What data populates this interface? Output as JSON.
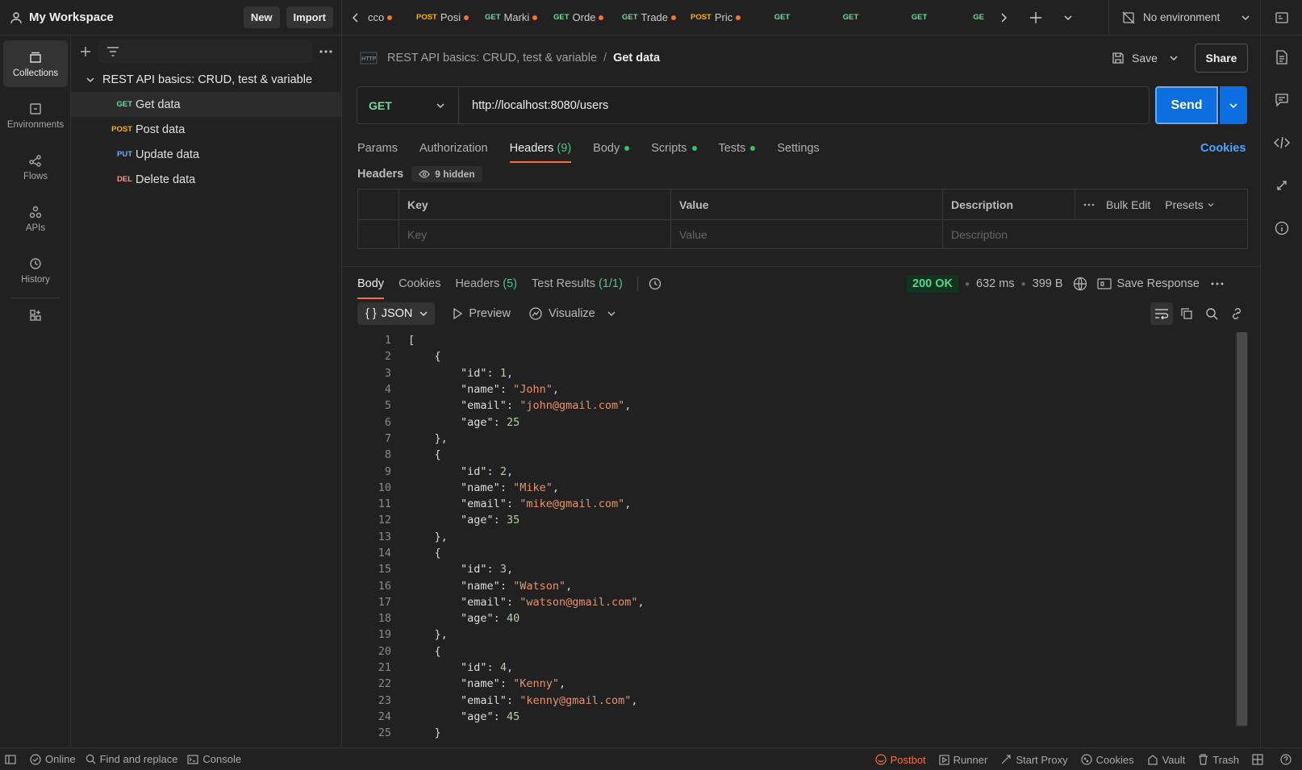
{
  "workspace": {
    "title": "My Workspace",
    "new_label": "New",
    "import_label": "Import"
  },
  "rail": [
    {
      "label": "Collections",
      "icon": "collections-icon"
    },
    {
      "label": "Environments",
      "icon": "environments-icon"
    },
    {
      "label": "Flows",
      "icon": "flows-icon"
    },
    {
      "label": "APIs",
      "icon": "apis-icon"
    },
    {
      "label": "History",
      "icon": "history-icon"
    }
  ],
  "sidebar": {
    "collection": "REST API basics: CRUD, test & variable",
    "requests": [
      {
        "method": "GET",
        "name": "Get data",
        "color": "#6bdd9a"
      },
      {
        "method": "POST",
        "name": "Post data",
        "color": "#ffb400"
      },
      {
        "method": "PUT",
        "name": "Update data",
        "color": "#74aef6"
      },
      {
        "method": "DEL",
        "name": "Delete data",
        "color": "#f79a8e"
      }
    ]
  },
  "tabs": [
    {
      "method": "",
      "name": "cco",
      "dot": true
    },
    {
      "method": "POST",
      "name": "Posi",
      "dot": true
    },
    {
      "method": "GET",
      "name": "Marki",
      "dot": true
    },
    {
      "method": "GET",
      "name": "Orde",
      "dot": true
    },
    {
      "method": "GET",
      "name": "Trade",
      "dot": true
    },
    {
      "method": "POST",
      "name": "Pric",
      "dot": true
    },
    {
      "method": "GET",
      "name": "",
      "dot": false
    },
    {
      "method": "GET",
      "name": "",
      "dot": false
    },
    {
      "method": "GET",
      "name": "",
      "dot": false
    },
    {
      "method": "GE",
      "name": "",
      "dot": false
    }
  ],
  "environment": "No environment",
  "request": {
    "breadcrumb_collection": "REST API basics: CRUD, test & variable",
    "breadcrumb_sep": "/",
    "breadcrumb_request": "Get data",
    "save_label": "Save",
    "share_label": "Share",
    "method": "GET",
    "url": "http://localhost:8080/users",
    "send_label": "Send",
    "tabs": {
      "params": "Params",
      "authorization": "Authorization",
      "headers": "Headers",
      "headers_count": "(9)",
      "body": "Body",
      "scripts": "Scripts",
      "tests": "Tests",
      "settings": "Settings"
    },
    "cookies_link": "Cookies",
    "headers_label": "Headers",
    "hidden_label": "9 hidden",
    "table": {
      "key": "Key",
      "value": "Value",
      "description": "Description",
      "bulk_edit": "Bulk Edit",
      "presets": "Presets",
      "key_ph": "Key",
      "value_ph": "Value",
      "description_ph": "Description"
    }
  },
  "response": {
    "tabs": {
      "body": "Body",
      "cookies": "Cookies",
      "headers": "Headers",
      "headers_count": "(5)",
      "tests": "Test Results",
      "tests_count": "(1/1)"
    },
    "status": "200 OK",
    "time": "632 ms",
    "size": "399 B",
    "save_response": "Save Response",
    "format": "JSON",
    "preview": "Preview",
    "visualize": "Visualize",
    "lines": [
      "[",
      "    {",
      "        \"id\": 1,",
      "        \"name\": \"John\",",
      "        \"email\": \"john@gmail.com\",",
      "        \"age\": 25",
      "    },",
      "    {",
      "        \"id\": 2,",
      "        \"name\": \"Mike\",",
      "        \"email\": \"mike@gmail.com\",",
      "        \"age\": 35",
      "    },",
      "    {",
      "        \"id\": 3,",
      "        \"name\": \"Watson\",",
      "        \"email\": \"watson@gmail.com\",",
      "        \"age\": 40",
      "    },",
      "    {",
      "        \"id\": 4,",
      "        \"name\": \"Kenny\",",
      "        \"email\": \"kenny@gmail.com\",",
      "        \"age\": 45",
      "    }"
    ]
  },
  "statusbar": {
    "online": "Online",
    "find_replace": "Find and replace",
    "console": "Console",
    "postbot": "Postbot",
    "runner": "Runner",
    "start_proxy": "Start Proxy",
    "cookies": "Cookies",
    "vault": "Vault",
    "trash": "Trash"
  },
  "colors": {
    "accent": "#ff6c37",
    "send": "#0c6fe0",
    "get": "#6bdd9a",
    "post": "#ffb400",
    "put": "#74aef6",
    "del": "#f79a8e",
    "ok": "#4fd88a"
  }
}
